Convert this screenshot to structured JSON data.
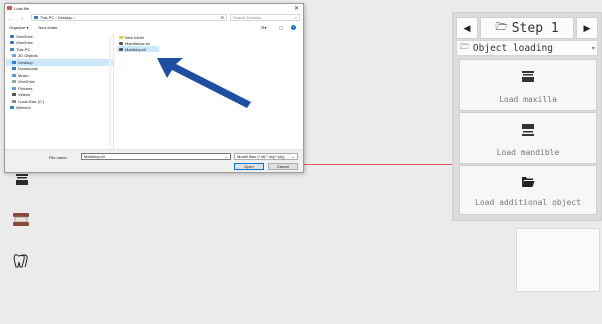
{
  "app": {
    "step_title": "Step 1",
    "section_label": "Object loading",
    "cards": [
      {
        "label": "Load maxilla",
        "icon": "maxilla-icon"
      },
      {
        "label": "Load mandible",
        "icon": "mandible-icon"
      },
      {
        "label": "Load additional object",
        "icon": "folder-open-icon"
      }
    ],
    "colors": {
      "accent_arrow": "#1f4fa3",
      "red_line": "#e35b4b"
    }
  },
  "dialog": {
    "title": "Load file",
    "address_path": "This PC › Desktop ›",
    "search_placeholder": "Search Desktop",
    "organize_label": "Organize ▾",
    "new_folder_label": "New folder",
    "nav_items": [
      {
        "label": "OneDrive",
        "icon": "cloud-icon"
      },
      {
        "label": "OneDrive",
        "icon": "cloud-icon"
      },
      {
        "label": "This PC",
        "icon": "computer-icon"
      },
      {
        "label": "3D Objects",
        "icon": "cube-icon"
      },
      {
        "label": "Desktop",
        "icon": "desktop-icon",
        "selected": true
      },
      {
        "label": "Downloads",
        "icon": "download-icon"
      },
      {
        "label": "Music",
        "icon": "music-icon"
      },
      {
        "label": "OneDrive",
        "icon": "cloud-icon"
      },
      {
        "label": "Pictures",
        "icon": "picture-icon"
      },
      {
        "label": "Videos",
        "icon": "video-icon"
      },
      {
        "label": "Local Disk (C:)",
        "icon": "disk-icon"
      },
      {
        "label": "Network",
        "icon": "network-icon"
      }
    ],
    "files": [
      {
        "label": "New folder",
        "icon": "folder-icon"
      },
      {
        "label": "Mandibular.stl",
        "icon": "stl-file-icon"
      },
      {
        "label": "Maxillary.stl",
        "icon": "stl-file-icon",
        "selected": true
      }
    ],
    "file_name_label": "File name:",
    "file_name_value": "Maxillary.stl",
    "file_type_value": "Model files (*.stl;*.obj;*.ply)",
    "open_label": "Open",
    "cancel_label": "Cancel"
  }
}
